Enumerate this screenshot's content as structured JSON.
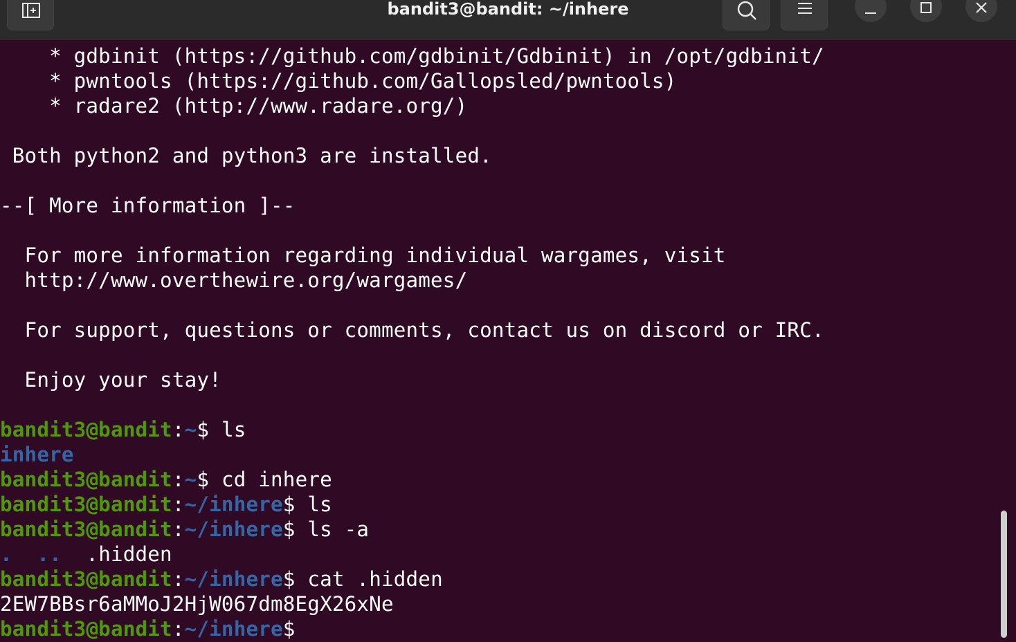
{
  "window": {
    "title": "bandit3@bandit: ~/inhere",
    "buttons": {
      "new_tab": "new-tab-icon",
      "search": "search-icon",
      "menu": "hamburger-menu-icon",
      "minimize": "minimize-icon",
      "maximize": "maximize-icon",
      "close": "close-icon"
    }
  },
  "colors": {
    "background": "#300a24",
    "prompt_user": "#4e9a06",
    "prompt_path": "#3465a4",
    "text": "#ffffff"
  },
  "terminal": {
    "motd": [
      "    * gdbinit (https://github.com/gdbinit/Gdbinit) in /opt/gdbinit/",
      "    * pwntools (https://github.com/Gallopsled/pwntools)",
      "    * radare2 (http://www.radare.org/)",
      " Both python2 and python3 are installed.",
      "--[ More information ]--",
      "  For more information regarding individual wargames, visit",
      "  http://www.overthewire.org/wargames/",
      "  For support, questions or comments, contact us on discord or IRC.",
      "  Enjoy your stay!"
    ],
    "prompt_user": "bandit3@bandit",
    "colon": ":",
    "dollar": "$ ",
    "dollar_bare": "$",
    "path_home": "~",
    "path_inhere": "~/inhere",
    "commands": [
      "ls",
      "cd inhere",
      "ls",
      "ls -a",
      "cat .hidden"
    ],
    "outputs": {
      "ls_home": "inhere",
      "ls_a_dots": ".  ..  ",
      "ls_a_hidden": ".hidden",
      "password": "2EW7BBsr6aMMoJ2HjW067dm8EgX26xNe"
    }
  }
}
